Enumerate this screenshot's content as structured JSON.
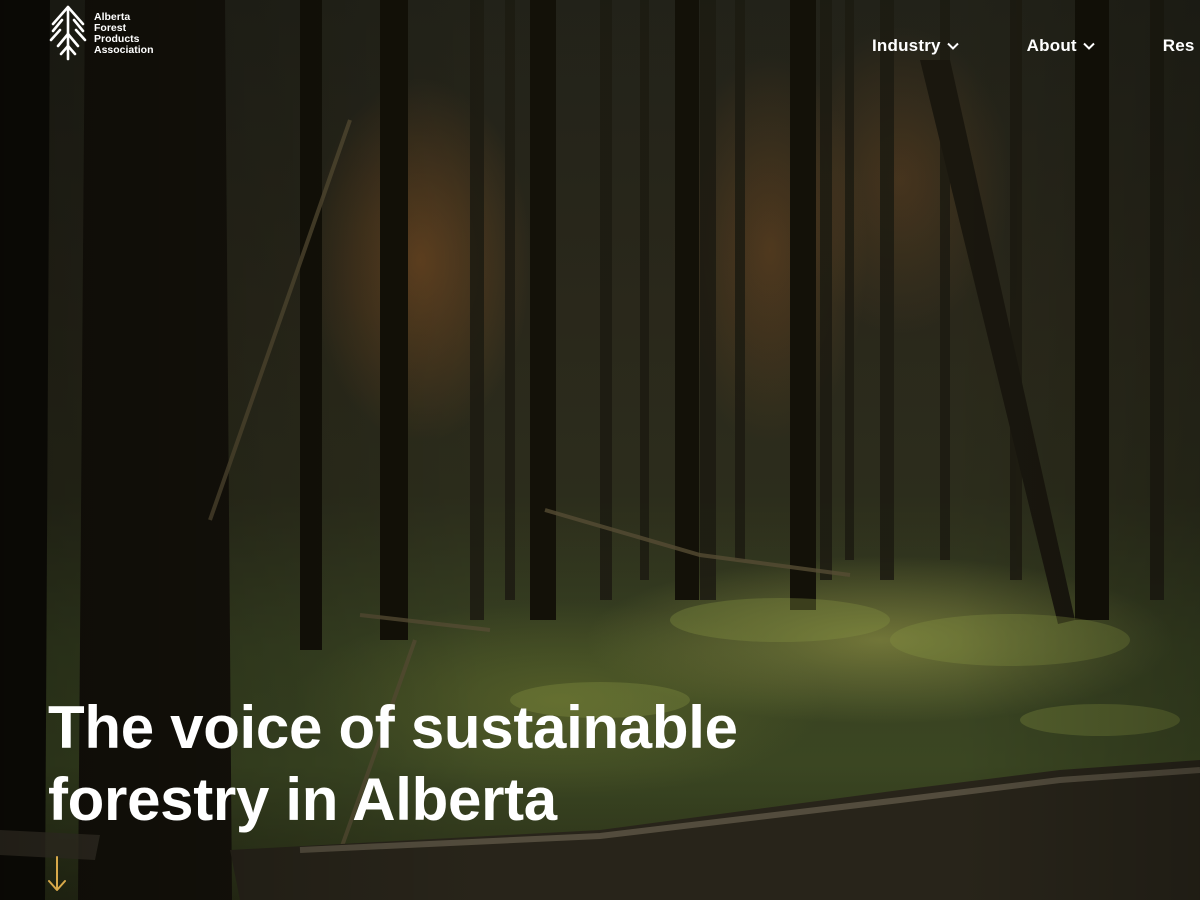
{
  "logo": {
    "line1": "Alberta",
    "line2": "Forest",
    "line3": "Products",
    "line4": "Association",
    "icon": "tree-icon"
  },
  "nav": {
    "items": [
      {
        "label": "Industry",
        "icon": "chevron-down-icon"
      },
      {
        "label": "About",
        "icon": "chevron-down-icon"
      },
      {
        "label": "Res"
      }
    ]
  },
  "hero": {
    "headline_line1": "The voice of sustainable",
    "headline_line2": "forestry in Alberta",
    "scroll_icon": "arrow-down-icon",
    "accent_color": "#d8a94a"
  }
}
